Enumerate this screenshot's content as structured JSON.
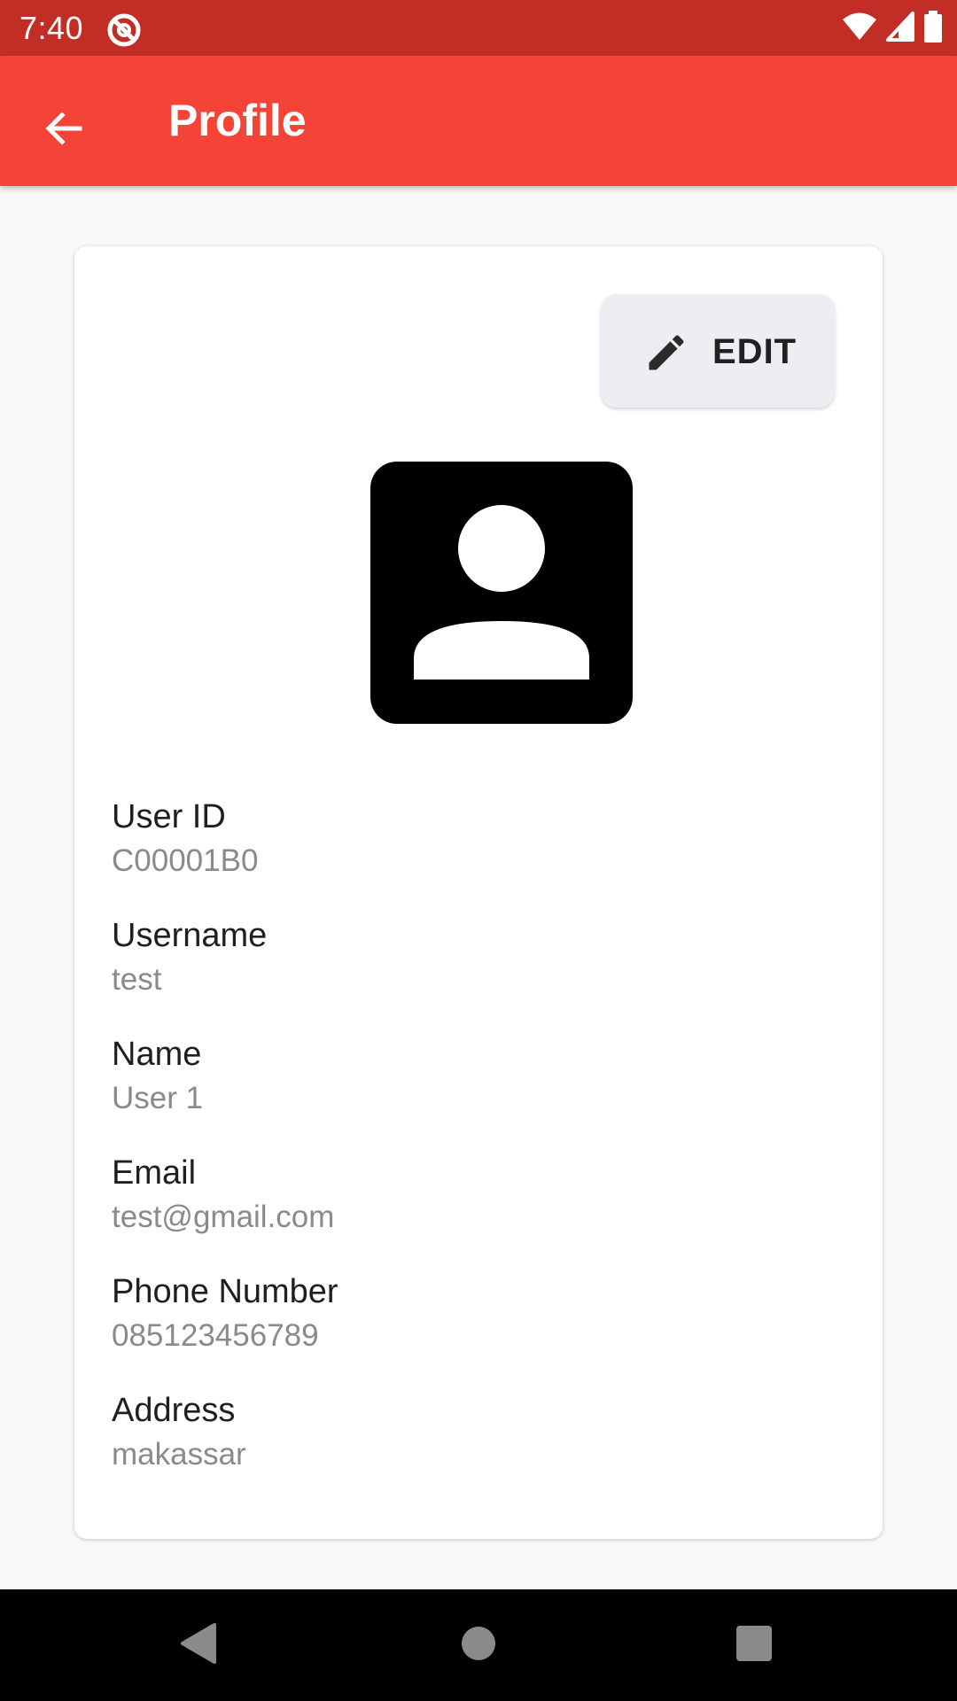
{
  "status_bar": {
    "time": "7:40",
    "app_icon": "do-not-disturb-icon",
    "wifi_icon": "wifi-icon",
    "signal_icon": "cell-signal-icon",
    "battery_icon": "battery-icon"
  },
  "app_bar": {
    "title": "Profile",
    "back_icon": "arrow-back-icon",
    "color": "#f44437",
    "status_color": "#c22d26"
  },
  "card": {
    "edit_label": "EDIT",
    "edit_icon": "pencil-icon",
    "avatar_icon": "account-box-icon",
    "fields": [
      {
        "label": "User ID",
        "value": "C00001B0"
      },
      {
        "label": "Username",
        "value": "test"
      },
      {
        "label": "Name",
        "value": "User 1"
      },
      {
        "label": "Email",
        "value": "test@gmail.com"
      },
      {
        "label": "Phone Number",
        "value": "085123456789"
      },
      {
        "label": "Address",
        "value": "makassar"
      }
    ]
  },
  "nav_bar": {
    "back_icon": "triangle-back-icon",
    "home_icon": "circle-home-icon",
    "recents_icon": "square-recents-icon"
  }
}
